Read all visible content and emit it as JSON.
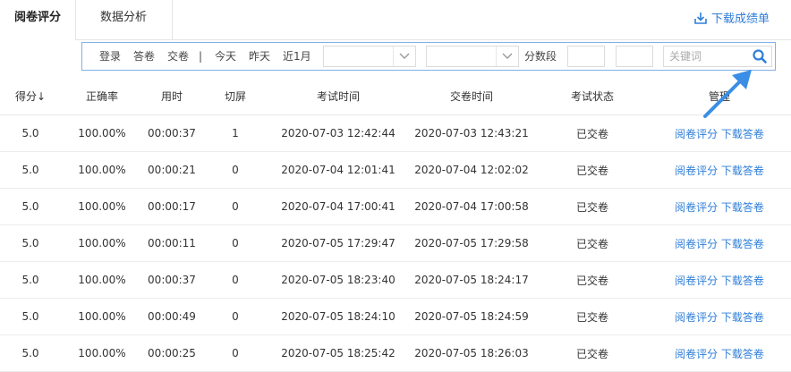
{
  "tabs": {
    "active": "阅卷评分",
    "inactive": "数据分析"
  },
  "download_label": "下载成绩单",
  "filters": {
    "items": [
      "登录",
      "答卷",
      "交卷"
    ],
    "separator": "|",
    "dates": [
      "今天",
      "昨天",
      "近1月"
    ],
    "score_range_label": "分数段",
    "keyword_placeholder": "关键词"
  },
  "table": {
    "headers": [
      "得分↓",
      "正确率",
      "用时",
      "切屏",
      "考试时间",
      "交卷时间",
      "考试状态",
      "管理"
    ],
    "action_labels": {
      "review": "阅卷评分",
      "download": "下载答卷"
    },
    "rows": [
      {
        "score": "5.0",
        "accuracy": "100.00%",
        "duration": "00:00:37",
        "switches": "1",
        "start": "2020-07-03 12:42:44",
        "submit": "2020-07-03 12:43:21",
        "status": "已交卷"
      },
      {
        "score": "5.0",
        "accuracy": "100.00%",
        "duration": "00:00:21",
        "switches": "0",
        "start": "2020-07-04 12:01:41",
        "submit": "2020-07-04 12:02:02",
        "status": "已交卷"
      },
      {
        "score": "5.0",
        "accuracy": "100.00%",
        "duration": "00:00:17",
        "switches": "0",
        "start": "2020-07-04 17:00:41",
        "submit": "2020-07-04 17:00:58",
        "status": "已交卷"
      },
      {
        "score": "5.0",
        "accuracy": "100.00%",
        "duration": "00:00:11",
        "switches": "0",
        "start": "2020-07-05 17:29:47",
        "submit": "2020-07-05 17:29:58",
        "status": "已交卷"
      },
      {
        "score": "5.0",
        "accuracy": "100.00%",
        "duration": "00:00:37",
        "switches": "0",
        "start": "2020-07-05 18:23:40",
        "submit": "2020-07-05 18:24:17",
        "status": "已交卷"
      },
      {
        "score": "5.0",
        "accuracy": "100.00%",
        "duration": "00:00:49",
        "switches": "0",
        "start": "2020-07-05 18:24:10",
        "submit": "2020-07-05 18:24:59",
        "status": "已交卷"
      },
      {
        "score": "5.0",
        "accuracy": "100.00%",
        "duration": "00:00:25",
        "switches": "0",
        "start": "2020-07-05 18:25:42",
        "submit": "2020-07-05 18:26:03",
        "status": "已交卷"
      }
    ]
  },
  "colors": {
    "link": "#2f7ed8",
    "accent_arrow": "#3a8ee6",
    "filter_border": "#7fb0e6"
  },
  "icons": {
    "download": "download-icon",
    "search": "search-icon",
    "dropdown": "chevron-down-icon",
    "pointer": "annotation-arrow-icon"
  }
}
